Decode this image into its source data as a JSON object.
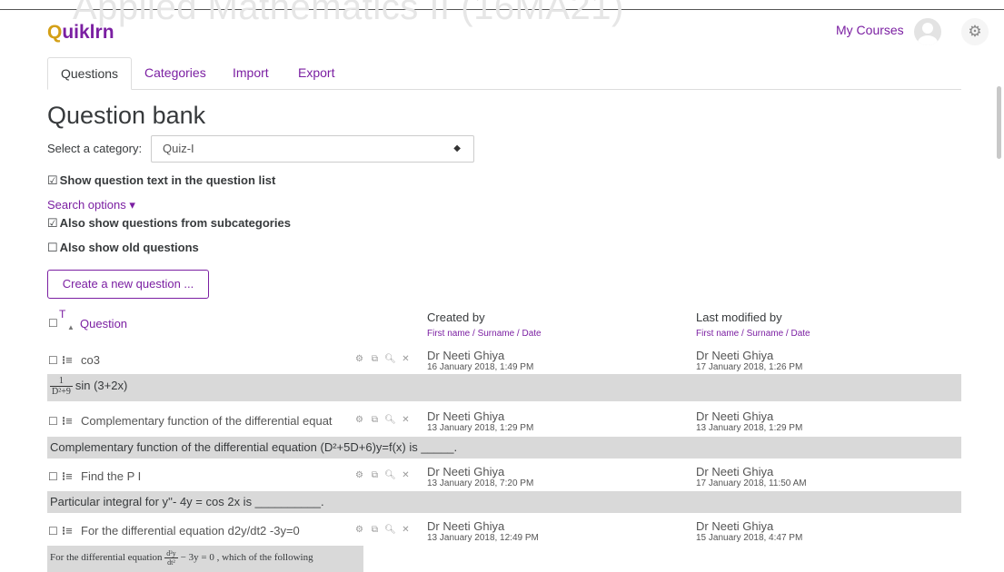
{
  "header": {
    "faded_title": "Applied Mathematics II (16MA21)",
    "logo_q": "Q",
    "logo_rest": "uiklrn",
    "my_courses": "My Courses"
  },
  "tabs": [
    {
      "label": "Questions",
      "active": true
    },
    {
      "label": "Categories",
      "active": false
    },
    {
      "label": "Import",
      "active": false
    },
    {
      "label": "Export",
      "active": false
    }
  ],
  "page_title": "Question bank",
  "category": {
    "label": "Select a category:",
    "value": "Quiz-I"
  },
  "options": {
    "show_text": {
      "box": "☑",
      "label": "Show question text in the question list"
    },
    "search_options": "Search options ▾",
    "subcategories": {
      "box": "☑",
      "label": "Also show questions from subcategories"
    },
    "old_questions": {
      "box": "☐",
      "label": "Also show old questions"
    }
  },
  "create_button": "Create a new question ...",
  "table": {
    "col_t": "T",
    "col_question": "Question",
    "created_by": "Created by",
    "created_sub": "First name / Surname / Date",
    "modified_by": "Last modified by",
    "modified_sub": "First name / Surname / Date",
    "rows": [
      {
        "name": "co3",
        "created_by": "Dr Neeti Ghiya",
        "created_date": "16 January 2018, 1:49 PM",
        "modified_by": "Dr Neeti Ghiya",
        "modified_date": "17 January 2018, 1:26 PM",
        "text_num": "1",
        "text_den": "D²+9",
        "text_rest": "sin (3+2x)"
      },
      {
        "name": "Complementary function of the differential equat",
        "created_by": "Dr Neeti Ghiya",
        "created_date": "13 January 2018, 1:29 PM",
        "modified_by": "Dr Neeti Ghiya",
        "modified_date": "13 January 2018, 1:29 PM",
        "text": "Complementary function of the differential equation (D²+5D+6)y=f(x) is _____."
      },
      {
        "name": "Find the P I",
        "created_by": "Dr Neeti Ghiya",
        "created_date": "13 January 2018, 7:20 PM",
        "modified_by": "Dr Neeti Ghiya",
        "modified_date": "17 January 2018, 11:50 AM",
        "text": "Particular integral for y''- 4y = cos 2x is __________."
      },
      {
        "name": "For the differential equation d2y/dt2 -3y=0",
        "created_by": "Dr Neeti Ghiya",
        "created_date": "13 January 2018, 12:49 PM",
        "modified_by": "Dr Neeti Ghiya",
        "modified_date": "15 January 2018, 4:47 PM",
        "text_a": "For the differential equation",
        "text_num": "d²y",
        "text_den": "dt²",
        "text_b": "− 3y = 0 , which of the following"
      }
    ]
  }
}
